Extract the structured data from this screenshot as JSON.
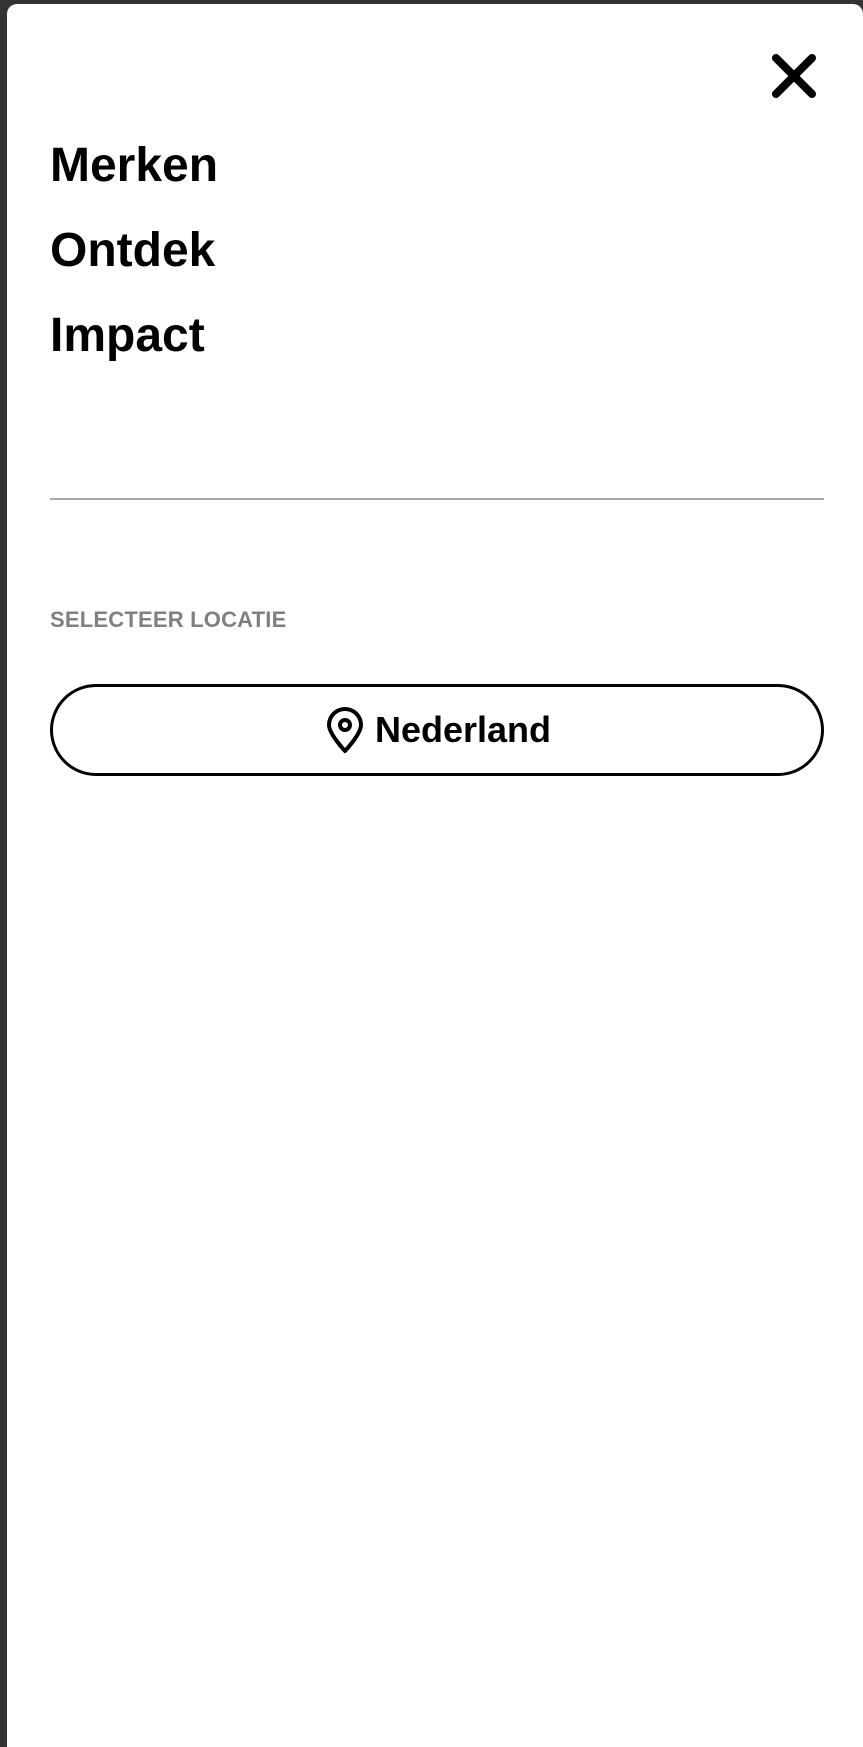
{
  "menu": {
    "items": [
      {
        "label": "Merken"
      },
      {
        "label": "Ontdek"
      },
      {
        "label": "Impact"
      }
    ]
  },
  "location": {
    "section_label": "SELECTEER LOCATIE",
    "selected": "Nederland"
  },
  "icons": {
    "close": "close-icon",
    "location": "map-pin-icon"
  },
  "colors": {
    "text": "#000000",
    "muted_label": "#808080",
    "divider": "#a8a8a8",
    "backdrop": "#333333",
    "panel": "#ffffff"
  }
}
